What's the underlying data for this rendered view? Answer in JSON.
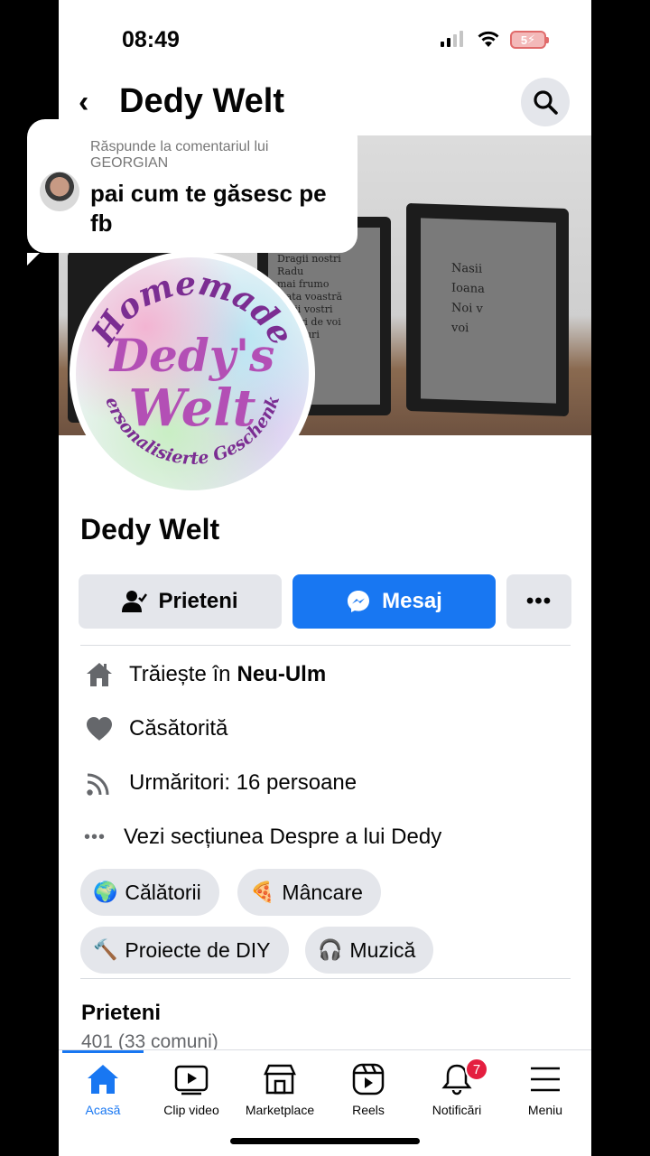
{
  "status": {
    "time": "08:49",
    "battery": "5"
  },
  "header": {
    "title": "Dedy Welt"
  },
  "comment": {
    "reply_label": "Răspunde la comentariul lui GEORGIAN",
    "text": "pai cum te găsesc pe fb"
  },
  "cover": {
    "frame1_text": "Dragii nostri\nRadu\nmai frumo\nviata voastră\nnasii vostri\nnaturi de voi\nsi securi",
    "frame2_text": "Nasii\nIoana\nNoi v\nvoi"
  },
  "logo": {
    "line1": "Homemade",
    "line2": "Dedy's",
    "line3": "Welt",
    "line4": "Personalisierte Geschenke"
  },
  "profile": {
    "name": "Dedy Welt"
  },
  "actions": {
    "friends": "Prieteni",
    "message": "Mesaj",
    "more": "•••"
  },
  "info": {
    "lives_prefix": "Trăiește în",
    "lives_city": "Neu-Ulm",
    "relationship": "Căsătorită",
    "followers": "Urmăritori: 16 persoane",
    "about": "Vezi secțiunea Despre a lui Dedy"
  },
  "hobbies": [
    {
      "icon": "🌍",
      "label": "Călătorii"
    },
    {
      "icon": "🍕",
      "label": "Mâncare"
    },
    {
      "icon": "🔨",
      "label": "Proiecte de DIY"
    },
    {
      "icon": "🎧",
      "label": "Muzică"
    }
  ],
  "friends": {
    "title": "Prieteni",
    "count": "401 (33 comuni)"
  },
  "nav": {
    "items": [
      {
        "label": "Acasă",
        "icon": "home-icon"
      },
      {
        "label": "Clip video",
        "icon": "video-icon"
      },
      {
        "label": "Marketplace",
        "icon": "marketplace-icon"
      },
      {
        "label": "Reels",
        "icon": "reels-icon"
      },
      {
        "label": "Notificări",
        "icon": "bell-icon",
        "badge": "7"
      },
      {
        "label": "Meniu",
        "icon": "menu-icon"
      }
    ]
  },
  "colors": {
    "accent": "#1877f2",
    "badge": "#e41e3f",
    "logo_text": "#b34fb5"
  }
}
